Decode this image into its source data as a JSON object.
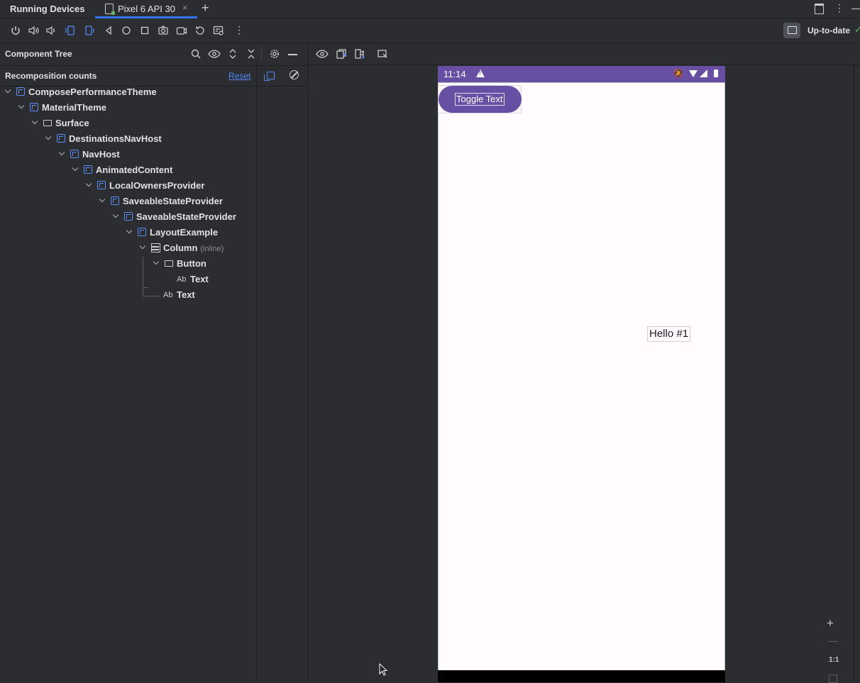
{
  "window": {
    "tool_title": "Running Devices",
    "device_tab_label": "Pixel 6 API 30",
    "close_glyph": "×",
    "add_glyph": "+",
    "more_glyph": "⋮"
  },
  "toolbar": {
    "status": "Up-to-date",
    "status_check": "✓",
    "more_glyph": "⋮",
    "icons": [
      "power-icon",
      "volume-up-icon",
      "volume-down-icon",
      "rotate-left-icon",
      "rotate-right-icon",
      "back-icon",
      "home-icon",
      "overview-icon",
      "screenshot-icon",
      "screen-record-icon",
      "reset-icon",
      "layout-inspector-icon",
      "more-icon"
    ]
  },
  "component_tree": {
    "title": "Component Tree",
    "recomposition_label": "Recomposition counts",
    "reset_label": "Reset",
    "nodes": [
      {
        "label": "ComposePerformanceTheme",
        "icon": "compose-cube-icon"
      },
      {
        "label": "MaterialTheme",
        "icon": "compose-cube-icon"
      },
      {
        "label": "Surface",
        "icon": "surface-rect-icon"
      },
      {
        "label": "DestinationsNavHost",
        "icon": "compose-cube-icon"
      },
      {
        "label": "NavHost",
        "icon": "compose-cube-icon"
      },
      {
        "label": "AnimatedContent",
        "icon": "compose-cube-icon"
      },
      {
        "label": "LocalOwnersProvider",
        "icon": "compose-cube-icon"
      },
      {
        "label": "SaveableStateProvider",
        "icon": "compose-cube-icon"
      },
      {
        "label": "SaveableStateProvider",
        "icon": "compose-cube-icon"
      },
      {
        "label": "LayoutExample",
        "icon": "compose-cube-icon"
      },
      {
        "label": "Column",
        "tag": "(inline)",
        "icon": "column-icon"
      },
      {
        "label": "Button",
        "icon": "button-rect-icon"
      },
      {
        "label": "Text",
        "icon": "text-ab-icon",
        "icon_text": "Ab"
      },
      {
        "label": "Text",
        "icon": "text-ab-icon",
        "icon_text": "Ab"
      }
    ]
  },
  "device": {
    "time": "11:14",
    "button_label": "Toggle Text",
    "hello_text": "Hello #1",
    "status_bar_color": "#6750a4",
    "background_color": "#fffbfe"
  },
  "zoom": {
    "zoom_in": "+",
    "one_to_one": "1:1"
  },
  "colors": {
    "accent": "#3574f0",
    "link": "#548af7",
    "success": "#5fb865",
    "panel_bg": "#2b2d30"
  }
}
